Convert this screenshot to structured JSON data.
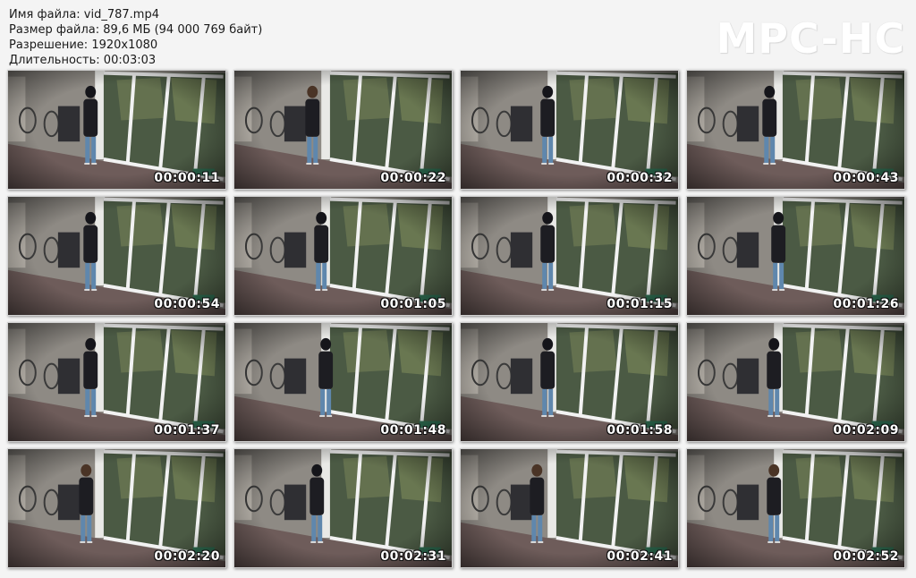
{
  "info": {
    "filename": "Имя файла: vid_787.mp4",
    "filesize": "Размер файла: 89,6 МБ (94 000 769 байт)",
    "resolution": "Разрешение: 1920x1080",
    "duration": "Длительность: 00:03:03"
  },
  "logo": "MPC-HC",
  "thumbnails": [
    {
      "time": "00:00:11",
      "person": {
        "pos": 0.38,
        "hair": "dark"
      }
    },
    {
      "time": "00:00:22",
      "person": {
        "pos": 0.36,
        "hair": "brown"
      }
    },
    {
      "time": "00:00:32",
      "person": {
        "pos": 0.4,
        "hair": "dark"
      }
    },
    {
      "time": "00:00:43",
      "person": {
        "pos": 0.38,
        "hair": "dark"
      }
    },
    {
      "time": "00:00:54",
      "person": {
        "pos": 0.38,
        "hair": "dark"
      }
    },
    {
      "time": "00:01:05",
      "person": {
        "pos": 0.4,
        "hair": "dark"
      }
    },
    {
      "time": "00:01:15",
      "person": {
        "pos": 0.4,
        "hair": "dark"
      }
    },
    {
      "time": "00:01:26",
      "person": {
        "pos": 0.42,
        "hair": "dark"
      }
    },
    {
      "time": "00:01:37",
      "person": {
        "pos": 0.38,
        "hair": "dark"
      }
    },
    {
      "time": "00:01:48",
      "person": {
        "pos": 0.42,
        "hair": "dark"
      }
    },
    {
      "time": "00:01:58",
      "person": {
        "pos": 0.4,
        "hair": "dark"
      }
    },
    {
      "time": "00:02:09",
      "person": {
        "pos": 0.4,
        "hair": "dark"
      }
    },
    {
      "time": "00:02:20",
      "person": {
        "pos": 0.36,
        "hair": "brown"
      }
    },
    {
      "time": "00:02:31",
      "person": {
        "pos": 0.38,
        "hair": "dark"
      }
    },
    {
      "time": "00:02:41",
      "person": {
        "pos": 0.35,
        "hair": "brown"
      }
    },
    {
      "time": "00:02:52",
      "person": {
        "pos": 0.4,
        "hair": "brown"
      }
    }
  ],
  "colors": {
    "wall": "#8e8a84",
    "floor": "#6e5c5a",
    "window_frame": "#f2f2f2",
    "glass": "#4b5a44",
    "jacket": "#1d1d22",
    "jeans": "#5f87ad"
  }
}
